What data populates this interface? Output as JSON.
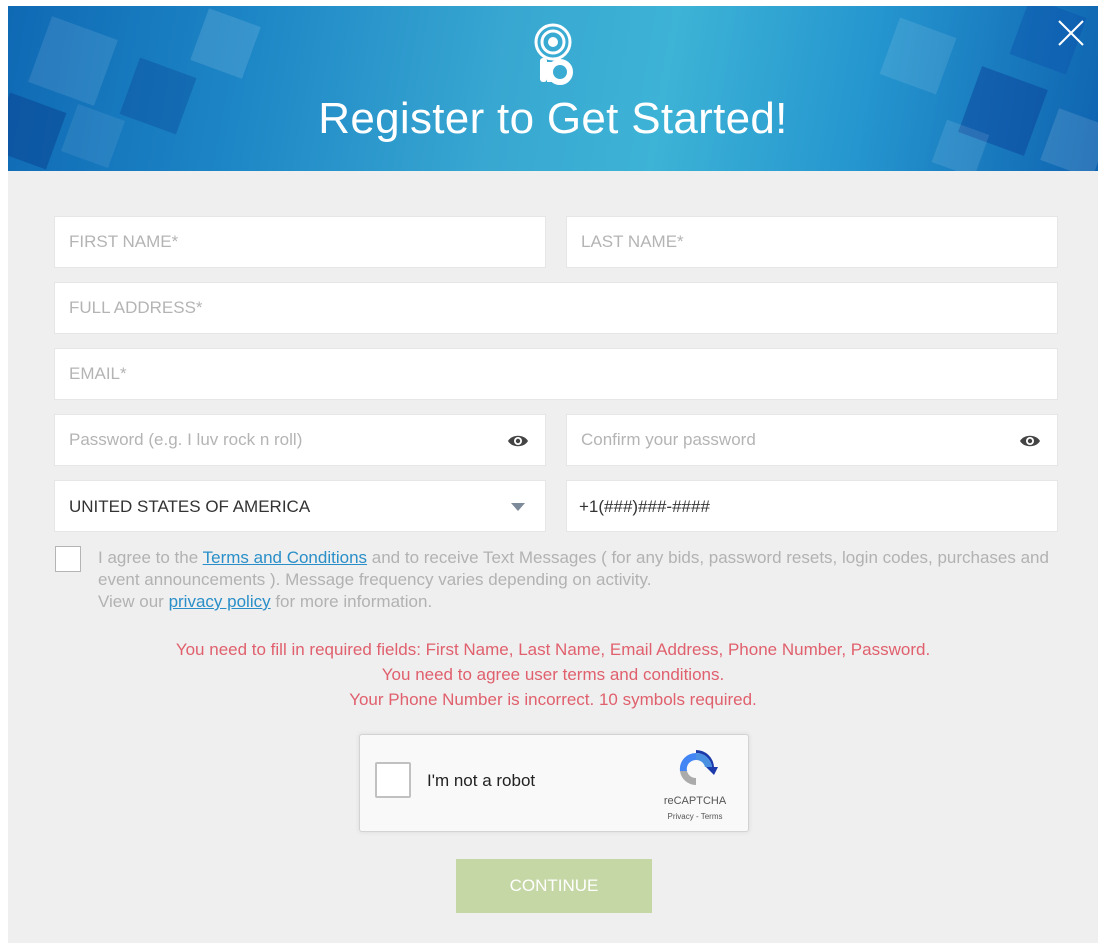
{
  "header": {
    "title": "Register to Get Started!",
    "logo_icon": "handbid-logo-icon",
    "close_icon": "close-icon"
  },
  "form": {
    "first_name_placeholder": "FIRST NAME*",
    "last_name_placeholder": "LAST NAME*",
    "address_placeholder": "FULL ADDRESS*",
    "email_placeholder": "EMAIL*",
    "password_placeholder": "Password (e.g. I luv rock n roll)",
    "confirm_password_placeholder": "Confirm your password",
    "country_value": "UNITED STATES OF AMERICA",
    "phone_value": "+1(###)###-####",
    "eye_icon": "eye-icon",
    "dropdown_icon": "caret-down-icon"
  },
  "agreement": {
    "prefix": "I agree to the ",
    "terms_link": "Terms and Conditions",
    "middle": " and to receive Text Messages ( for any bids, password resets, login codes, purchases and event announcements ). Message frequency varies depending on activity.",
    "view_prefix": "View our ",
    "privacy_link": "privacy policy",
    "view_suffix": " for more information."
  },
  "errors": [
    "You need to fill in required fields: First Name, Last Name, Email Address, Phone Number, Password.",
    "You need to agree user terms and conditions.",
    "Your Phone Number is incorrect. 10 symbols required."
  ],
  "recaptcha": {
    "label": "I'm not a robot",
    "brand": "reCAPTCHA",
    "links": "Privacy - Terms"
  },
  "continue_label": "CONTINUE",
  "colors": {
    "header_blue": "#2aa0d0",
    "error": "#e0606d",
    "link": "#2a8fc8",
    "continue_bg": "#c6d7a6"
  }
}
